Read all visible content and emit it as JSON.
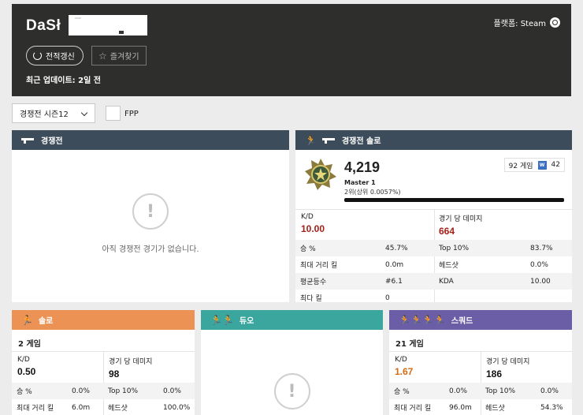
{
  "header": {
    "player_name": "DaSł",
    "platform_label": "플랫폼: Steam",
    "refresh_label": "전적갱신",
    "favorite_label": "즐겨찾기",
    "updated_text": "최근 업데이트: 2일 전"
  },
  "filters": {
    "season": "경쟁전 시즌12",
    "fpp_label": "FPP",
    "fpp_checked": false
  },
  "ranked_panel": {
    "title": "경쟁전",
    "empty_text": "아직 경쟁전 경기가 없습니다."
  },
  "ranked_solo": {
    "title": "경쟁전 솔로",
    "rating": "4,219",
    "tier": "Master 1",
    "rank_position": "2위(상위 0.0057%)",
    "games": "92 게임",
    "wins": "42",
    "win_icon": "W",
    "kd_label": "K/D",
    "kd_value": "10.00",
    "dmg_label": "경기 당 데미지",
    "dmg_value": "664",
    "rows": [
      {
        "l1": "승 %",
        "v1": "45.7%",
        "l2": "Top 10%",
        "v2": "83.7%"
      },
      {
        "l1": "최대 거리 킬",
        "v1": "0.0m",
        "l2": "헤드샷",
        "v2": "0.0%"
      },
      {
        "l1": "평균등수",
        "v1": "#6.1",
        "l2": "KDA",
        "v2": "10.00"
      },
      {
        "l1": "최다 킬",
        "v1": "0",
        "l2": "",
        "v2": ""
      }
    ]
  },
  "solo": {
    "title": "솔로",
    "games": "2 게임",
    "kd_label": "K/D",
    "kd_value": "0.50",
    "dmg_label": "경기 당 데미지",
    "dmg_value": "98",
    "rows": [
      {
        "l1": "승 %",
        "v1": "0.0%",
        "l2": "Top 10%",
        "v2": "0.0%"
      },
      {
        "l1": "최대 거리 킬",
        "v1": "6.0m",
        "l2": "헤드샷",
        "v2": "100.0%"
      }
    ]
  },
  "duo": {
    "title": "듀오"
  },
  "squad": {
    "title": "스쿼드",
    "games": "21 게임",
    "kd_label": "K/D",
    "kd_value": "1.67",
    "dmg_label": "경기 당 데미지",
    "dmg_value": "186",
    "rows": [
      {
        "l1": "승 %",
        "v1": "0.0%",
        "l2": "Top 10%",
        "v2": "0.0%"
      },
      {
        "l1": "최대 거리 킬",
        "v1": "96.0m",
        "l2": "헤드샷",
        "v2": "54.3%"
      }
    ]
  },
  "colors": {
    "header_bg": "#2e2e2c",
    "panel_head_dark": "#3d4c5a",
    "solo_orange": "#eb9254",
    "duo_teal": "#3aa69e",
    "squad_purple": "#6b5ea6",
    "kd_red": "#a32018",
    "kd_orange": "#d26b12"
  },
  "icons": {
    "refresh": "refresh-icon",
    "favorite": "star-icon",
    "platform": "steam-icon",
    "dropdown": "chevron-down-icon",
    "ranked": "gun-icon",
    "mode": "running-person-icon",
    "empty": "exclamation-circle-icon",
    "rank_badge": "master-rank-badge"
  }
}
